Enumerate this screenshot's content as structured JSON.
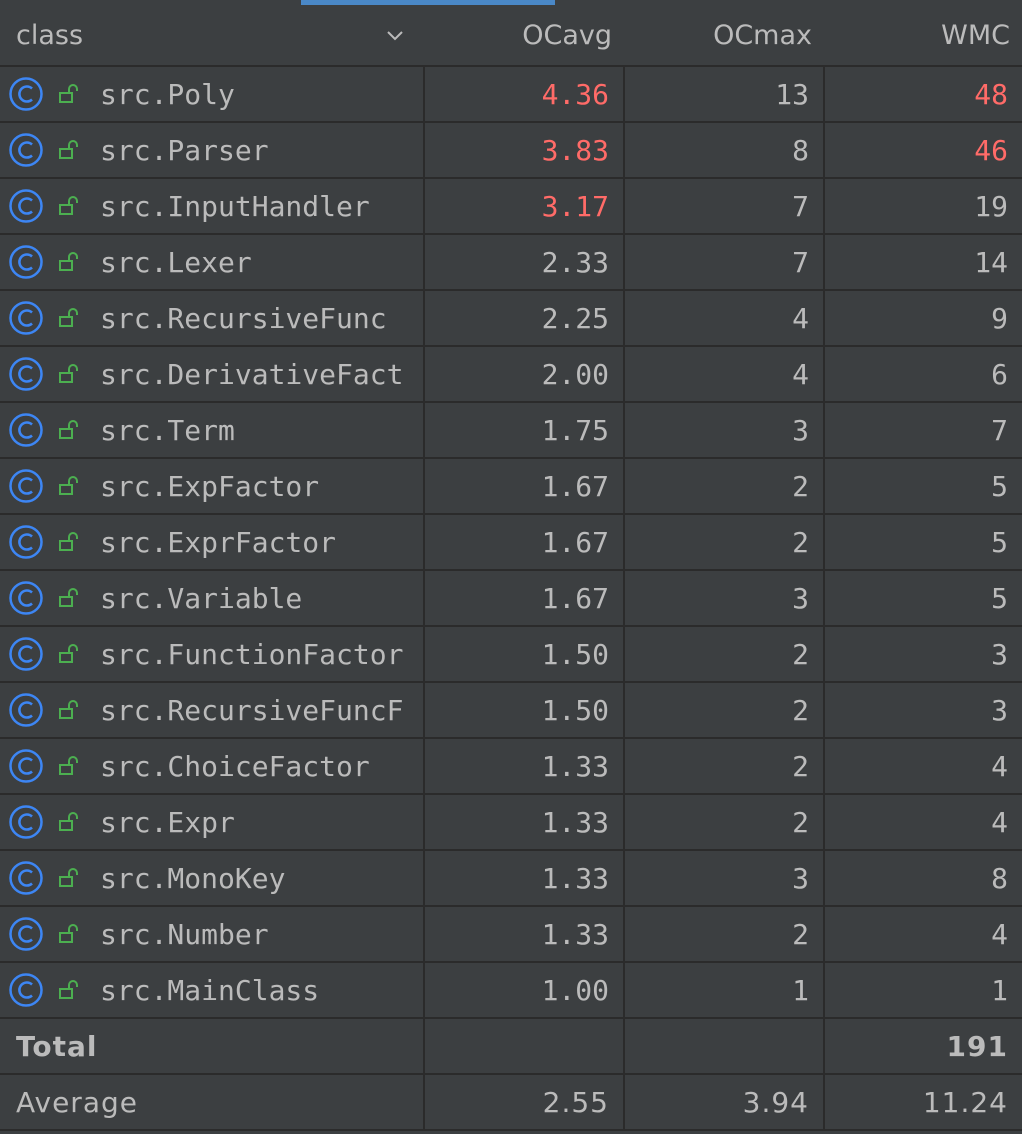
{
  "header": {
    "class": "class",
    "ocavg": "OCavg",
    "ocmax": "OCmax",
    "wmc": "WMC"
  },
  "colors": {
    "highlight": "#ff6b68",
    "class_icon": "#3d86f4",
    "lock_icon": "#4caf50"
  },
  "rows": [
    {
      "name": "src.Poly",
      "ocavg": "4.36",
      "ocmax": "13",
      "wmc": "48",
      "ocavg_hl": true,
      "wmc_hl": true
    },
    {
      "name": "src.Parser",
      "ocavg": "3.83",
      "ocmax": "8",
      "wmc": "46",
      "ocavg_hl": true,
      "wmc_hl": true
    },
    {
      "name": "src.InputHandler",
      "ocavg": "3.17",
      "ocmax": "7",
      "wmc": "19",
      "ocavg_hl": true,
      "wmc_hl": false
    },
    {
      "name": "src.Lexer",
      "ocavg": "2.33",
      "ocmax": "7",
      "wmc": "14",
      "ocavg_hl": false,
      "wmc_hl": false
    },
    {
      "name": "src.RecursiveFunc",
      "ocavg": "2.25",
      "ocmax": "4",
      "wmc": "9",
      "ocavg_hl": false,
      "wmc_hl": false
    },
    {
      "name": "src.DerivativeFact",
      "ocavg": "2.00",
      "ocmax": "4",
      "wmc": "6",
      "ocavg_hl": false,
      "wmc_hl": false
    },
    {
      "name": "src.Term",
      "ocavg": "1.75",
      "ocmax": "3",
      "wmc": "7",
      "ocavg_hl": false,
      "wmc_hl": false
    },
    {
      "name": "src.ExpFactor",
      "ocavg": "1.67",
      "ocmax": "2",
      "wmc": "5",
      "ocavg_hl": false,
      "wmc_hl": false
    },
    {
      "name": "src.ExprFactor",
      "ocavg": "1.67",
      "ocmax": "2",
      "wmc": "5",
      "ocavg_hl": false,
      "wmc_hl": false
    },
    {
      "name": "src.Variable",
      "ocavg": "1.67",
      "ocmax": "3",
      "wmc": "5",
      "ocavg_hl": false,
      "wmc_hl": false
    },
    {
      "name": "src.FunctionFactor",
      "ocavg": "1.50",
      "ocmax": "2",
      "wmc": "3",
      "ocavg_hl": false,
      "wmc_hl": false
    },
    {
      "name": "src.RecursiveFuncF",
      "ocavg": "1.50",
      "ocmax": "2",
      "wmc": "3",
      "ocavg_hl": false,
      "wmc_hl": false
    },
    {
      "name": "src.ChoiceFactor",
      "ocavg": "1.33",
      "ocmax": "2",
      "wmc": "4",
      "ocavg_hl": false,
      "wmc_hl": false
    },
    {
      "name": "src.Expr",
      "ocavg": "1.33",
      "ocmax": "2",
      "wmc": "4",
      "ocavg_hl": false,
      "wmc_hl": false
    },
    {
      "name": "src.MonoKey",
      "ocavg": "1.33",
      "ocmax": "3",
      "wmc": "8",
      "ocavg_hl": false,
      "wmc_hl": false
    },
    {
      "name": "src.Number",
      "ocavg": "1.33",
      "ocmax": "2",
      "wmc": "4",
      "ocavg_hl": false,
      "wmc_hl": false
    },
    {
      "name": "src.MainClass",
      "ocavg": "1.00",
      "ocmax": "1",
      "wmc": "1",
      "ocavg_hl": false,
      "wmc_hl": false
    }
  ],
  "total": {
    "label": "Total",
    "ocavg": "",
    "ocmax": "",
    "wmc": "191"
  },
  "average": {
    "label": "Average",
    "ocavg": "2.55",
    "ocmax": "3.94",
    "wmc": "11.24"
  }
}
